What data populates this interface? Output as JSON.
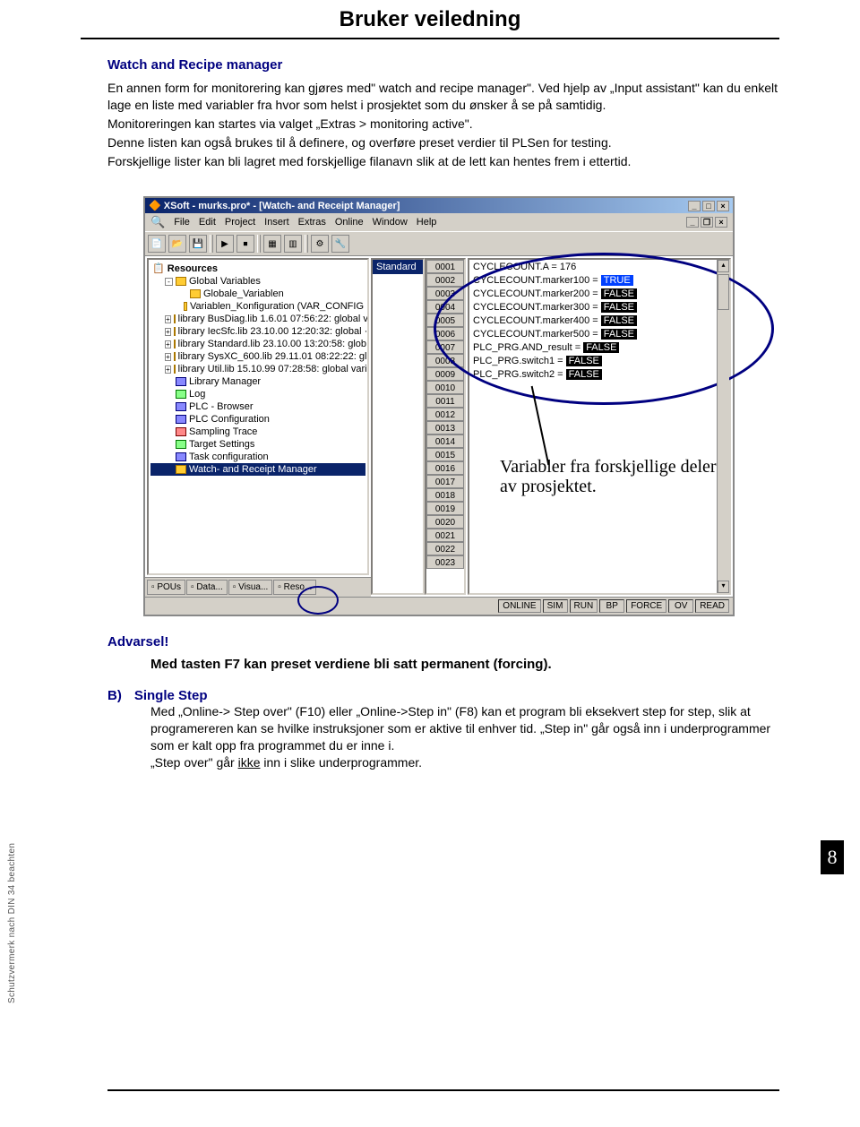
{
  "doc_title": "Bruker veiledning",
  "section1_title": "Watch and Recipe manager",
  "para1": "En annen form for monitorering kan gjøres med\" watch and recipe manager\". Ved hjelp av „Input assistant\" kan du enkelt lage en liste med variabler fra hvor som helst i prosjektet  som du ønsker å se på samtidig.",
  "para2": "Monitoreringen kan startes via valget „Extras > monitoring active\".",
  "para3": "Denne listen kan også brukes til å definere, og overføre preset verdier til PLSen for testing.",
  "para4": "Forskjellige lister kan bli lagret med forskjellige filanavn slik at de lett kan hentes frem i ettertid.",
  "win": {
    "title": "XSoft - murks.pro* - [Watch- and Receipt Manager]",
    "menu": [
      "File",
      "Edit",
      "Project",
      "Insert",
      "Extras",
      "Online",
      "Window",
      "Help"
    ],
    "std": "Standard",
    "tree_root": "Resources",
    "tree": [
      {
        "t": "Global Variables",
        "exp": "-"
      },
      {
        "t": "Globale_Variablen",
        "sub": true
      },
      {
        "t": "Variablen_Konfiguration (VAR_CONFIG",
        "sub": true
      },
      {
        "t": "library BusDiag.lib 1.6.01 07:56:22: global v",
        "exp": "+"
      },
      {
        "t": "library IecSfc.lib 23.10.00 12:20:32: global ·",
        "exp": "+"
      },
      {
        "t": "library Standard.lib 23.10.00 13:20:58: glob",
        "exp": "+"
      },
      {
        "t": "library SysXC_600.lib 29.11.01 08:22:22: gl",
        "exp": "+"
      },
      {
        "t": "library Util.lib 15.10.99 07:28:58: global vari",
        "exp": "+"
      },
      {
        "t": "Library Manager",
        "ico": "b"
      },
      {
        "t": "Log",
        "ico": "g"
      },
      {
        "t": "PLC - Browser",
        "ico": "b"
      },
      {
        "t": "PLC Configuration",
        "ico": "b"
      },
      {
        "t": "Sampling Trace",
        "ico": "r"
      },
      {
        "t": "Target Settings",
        "ico": "g"
      },
      {
        "t": "Task configuration",
        "ico": "b"
      },
      {
        "t": "Watch- and Receipt Manager",
        "sel": true
      }
    ],
    "tabs": [
      "POUs",
      "Data...",
      "Visua...",
      "Reso..."
    ],
    "rows": [
      "0001",
      "0002",
      "0003",
      "0004",
      "0005",
      "0006",
      "0007",
      "0008",
      "0009",
      "0010",
      "0011",
      "0012",
      "0013",
      "0014",
      "0015",
      "0016",
      "0017",
      "0018",
      "0019",
      "0020",
      "0021",
      "0022",
      "0023"
    ],
    "vals": [
      {
        "t": "CYCLECOUNT.A = 176"
      },
      {
        "t": "CYCLECOUNT.marker100 = ",
        "v": "TRUE",
        "cls": "t"
      },
      {
        "t": "CYCLECOUNT.marker200 = ",
        "v": "FALSE"
      },
      {
        "t": "CYCLECOUNT.marker300 = ",
        "v": "FALSE"
      },
      {
        "t": "CYCLECOUNT.marker400 = ",
        "v": "FALSE"
      },
      {
        "t": "CYCLECOUNT.marker500 = ",
        "v": "FALSE"
      },
      {
        "t": "PLC_PRG.AND_result = ",
        "v": "FALSE"
      },
      {
        "t": "PLC_PRG.switch1 = ",
        "v": "FALSE"
      },
      {
        "t": "PLC_PRG.switch2 = ",
        "v": "FALSE"
      }
    ],
    "status": [
      "ONLINE",
      "SIM",
      "RUN",
      "BP",
      "FORCE",
      "OV",
      "READ"
    ]
  },
  "annotation": "Variabler fra forskjellige deler av prosjektet.",
  "warning_label": "Advarsel!",
  "warning_text": "Med tasten F7 kan preset verdiene bli satt permanent (forcing).",
  "section_b_label": "B)",
  "section_b_title": "Single Step",
  "section_b_p1": "Med „Online-> Step over\" (F10) eller „Online->Step in\" (F8) kan et program bli eksekvert step for step, slik at programereren kan se hvilke instruksjoner som er aktive til enhver tid. „Step in\" går også inn i underprogrammer som er kalt opp fra programmet du er inne i.",
  "section_b_p2_a": "„Step over\" går ",
  "section_b_p2_u": "ikke",
  "section_b_p2_b": " inn i slike underprogrammer.",
  "page_num": "8",
  "side_note": "Schutzvermerk nach DIN 34 beachten"
}
